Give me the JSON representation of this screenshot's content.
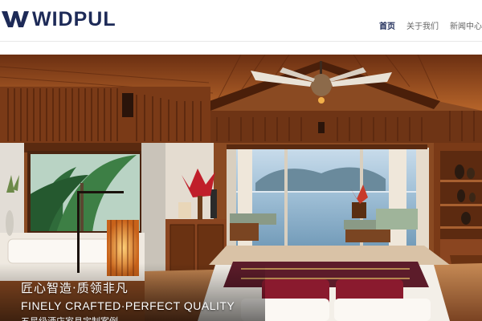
{
  "brand": {
    "name": "WIDPUL",
    "color": "#1d2a57",
    "icon": "w-logo-mark"
  },
  "nav": {
    "items": [
      {
        "label": "首页",
        "active": true
      },
      {
        "label": "关于我们",
        "active": false
      },
      {
        "label": "新闻中心",
        "active": false
      }
    ]
  },
  "hero": {
    "scene": "resort-bedroom-interior",
    "caption_cn": "匠心智造·质领非凡",
    "caption_en": "FINELY CRAFTED·PERFECT QUALITY",
    "caption_sub": "五星级酒店家具定制案例"
  }
}
